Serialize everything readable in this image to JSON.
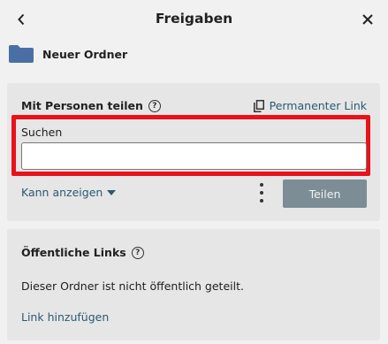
{
  "header": {
    "title": "Freigaben",
    "back_icon": "chevron-left-icon",
    "close_icon": "close-icon"
  },
  "folder": {
    "name": "Neuer Ordner",
    "icon": "folder-icon",
    "icon_color": "#4a6fa5"
  },
  "share_panel": {
    "heading": "Mit Personen teilen",
    "help_symbol": "?",
    "permanent_link_label": "Permanenter Link",
    "search_label": "Suchen",
    "search_value": "",
    "permission_label": "Kann anzeigen",
    "share_button_label": "Teilen",
    "highlight_color": "#e8121b"
  },
  "links_panel": {
    "heading": "Öffentliche Links",
    "help_symbol": "?",
    "status_text": "Dieser Ordner ist nicht öffentlich geteilt.",
    "add_link_label": "Link hinzufügen"
  },
  "colors": {
    "background": "#f1f1f1",
    "panel": "#e6e6e6",
    "link": "#2a5a72",
    "button": "#7c8d96"
  }
}
